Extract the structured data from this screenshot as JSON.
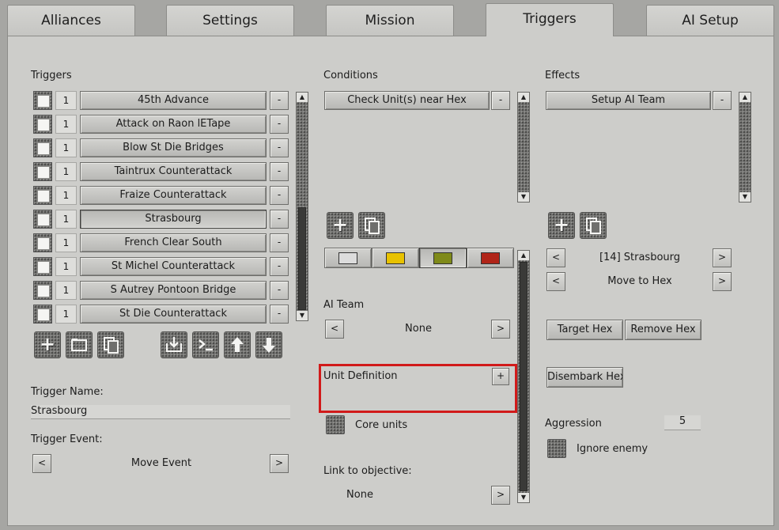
{
  "tabs": [
    "Alliances",
    "Settings",
    "Mission",
    "Triggers",
    "AI Setup"
  ],
  "active_tab": "Triggers",
  "triggers": {
    "heading": "Triggers",
    "items": [
      {
        "count": "1",
        "name": "45th Advance"
      },
      {
        "count": "1",
        "name": "Attack on Raon lETape"
      },
      {
        "count": "1",
        "name": "Blow St Die Bridges"
      },
      {
        "count": "1",
        "name": "Taintrux Counterattack"
      },
      {
        "count": "1",
        "name": "Fraize Counterattack"
      },
      {
        "count": "1",
        "name": "Strasbourg"
      },
      {
        "count": "1",
        "name": "French Clear South"
      },
      {
        "count": "1",
        "name": "St Michel Counterattack"
      },
      {
        "count": "1",
        "name": "S Autrey Pontoon Bridge"
      },
      {
        "count": "1",
        "name": "St Die Counterattack"
      }
    ],
    "selected_index": 5,
    "remove_label": "-",
    "name_label": "Trigger Name:",
    "name_value": "Strasbourg",
    "event_label": "Trigger Event:",
    "event_value": "Move Event",
    "prev": "<",
    "next": ">",
    "toolbar_icons": [
      "add-icon",
      "folder-icon",
      "copy-icon",
      "import-icon",
      "console-icon",
      "move-up-icon",
      "move-down-icon"
    ]
  },
  "conditions": {
    "heading": "Conditions",
    "items": [
      {
        "name": "Check Unit(s) near Hex"
      }
    ],
    "remove_label": "-",
    "colors": [
      "#dcdcdc",
      "#e8c200",
      "#7f8a1a",
      "#b02418"
    ],
    "selected_color_index": 2,
    "ai_team_label": "AI Team",
    "ai_team_value": "None",
    "prev": "<",
    "next": ">",
    "unit_def_label": "Unit Definition",
    "unit_def_btn": "+",
    "core_units_label": "Core units",
    "link_label": "Link to objective:",
    "link_value": "None"
  },
  "effects": {
    "heading": "Effects",
    "items": [
      {
        "name": "Setup AI Team"
      }
    ],
    "remove_label": "-",
    "selector1": "[14] Strasbourg",
    "selector2": "Move to Hex",
    "prev": "<",
    "next": ">",
    "target_hex": "Target Hex",
    "remove_hex": "Remove Hex",
    "disembark_hex": "Disembark Hex",
    "aggression_label": "Aggression",
    "aggression_value": "5",
    "ignore_enemy_label": "Ignore enemy"
  },
  "colors": {
    "panel": "#cdcdca",
    "highlight": "#d11a1a"
  }
}
